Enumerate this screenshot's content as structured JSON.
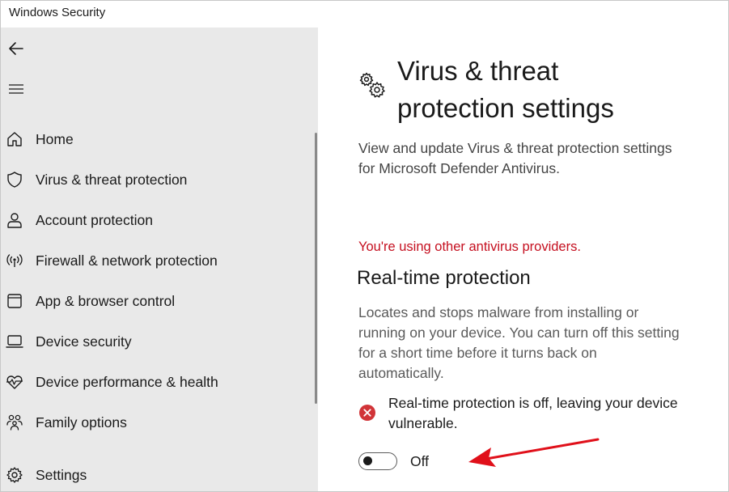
{
  "window": {
    "title": "Windows Security"
  },
  "sidebar": {
    "back_icon": "arrow-left-icon",
    "menu_icon": "hamburger-icon",
    "items": [
      {
        "label": "Home",
        "icon": "home-icon"
      },
      {
        "label": "Virus & threat protection",
        "icon": "shield-icon"
      },
      {
        "label": "Account protection",
        "icon": "person-icon"
      },
      {
        "label": "Firewall & network protection",
        "icon": "antenna-icon"
      },
      {
        "label": "App & browser control",
        "icon": "app-window-icon"
      },
      {
        "label": "Device security",
        "icon": "laptop-icon"
      },
      {
        "label": "Device performance & health",
        "icon": "heartbeat-icon"
      },
      {
        "label": "Family options",
        "icon": "family-icon"
      }
    ],
    "settings": {
      "label": "Settings",
      "icon": "gear-icon"
    }
  },
  "main": {
    "page_icon": "gears-icon",
    "title": "Virus & threat protection settings",
    "description": "View and update Virus & threat protection settings for Microsoft Defender Antivirus.",
    "warning": "You're using other antivirus providers.",
    "realtime": {
      "title": "Real-time protection",
      "description": "Locates and stops malware from installing or running on your device. You can turn off this setting for a short time before it turns back on automatically.",
      "alert_icon": "error-circle-icon",
      "alert_text": "Real-time protection is off, leaving your device vulnerable.",
      "toggle_state": "Off"
    }
  },
  "colors": {
    "sidebar_bg": "#e9e9e9",
    "warning": "#c50f1f",
    "error_icon": "#d13438",
    "annotation_arrow": "#e0101a"
  }
}
